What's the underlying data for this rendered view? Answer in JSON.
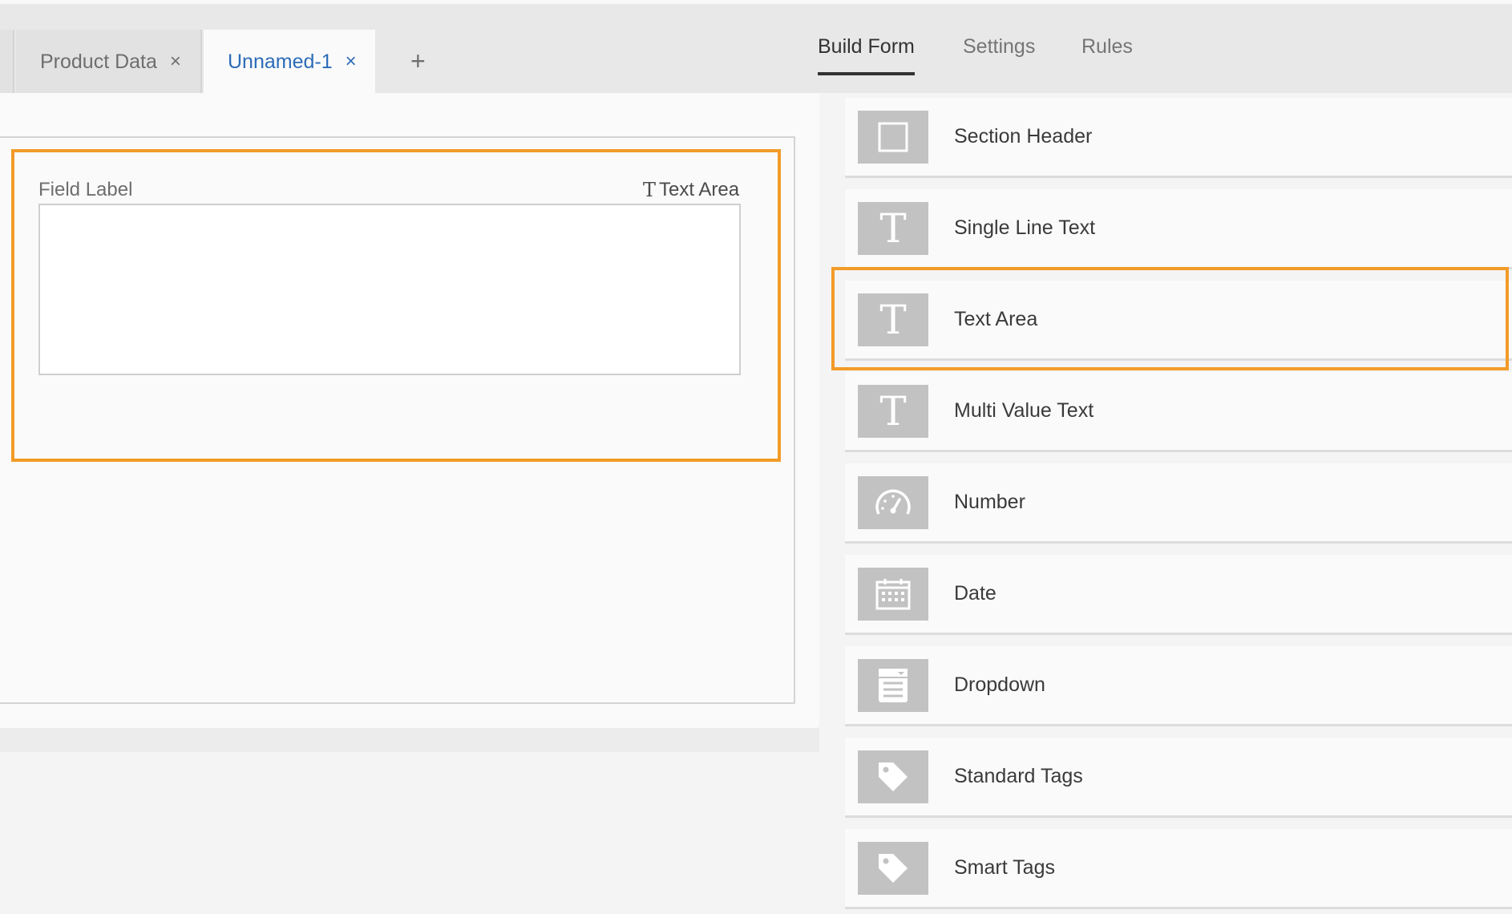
{
  "tabs": {
    "items": [
      {
        "label": "Product Data",
        "close": "×"
      },
      {
        "label": "Unnamed-1",
        "close": "×"
      }
    ],
    "add": "+"
  },
  "right_tabs": [
    {
      "label": "Build Form",
      "active": true
    },
    {
      "label": "Settings",
      "active": false
    },
    {
      "label": "Rules",
      "active": false
    }
  ],
  "form": {
    "field_label": "Field Label",
    "field_type_glyph": "T",
    "field_type": "Text Area"
  },
  "components": [
    {
      "label": "Section Header",
      "icon": "square-icon"
    },
    {
      "label": "Single Line Text",
      "icon": "text-icon"
    },
    {
      "label": "Text Area",
      "icon": "text-icon",
      "highlighted": true
    },
    {
      "label": "Multi Value Text",
      "icon": "text-icon"
    },
    {
      "label": "Number",
      "icon": "gauge-icon"
    },
    {
      "label": "Date",
      "icon": "calendar-icon"
    },
    {
      "label": "Dropdown",
      "icon": "dropdown-list-icon"
    },
    {
      "label": "Standard Tags",
      "icon": "tag-icon"
    },
    {
      "label": "Smart Tags",
      "icon": "tag-icon"
    }
  ],
  "colors": {
    "highlight": "#f29b28",
    "active_tab_text": "#2c6cb8",
    "icon_bg": "#c2c2c2"
  }
}
